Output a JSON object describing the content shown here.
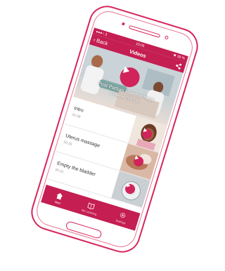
{
  "status": {
    "time": "15:05",
    "carrier": "3",
    "battery": "39 %"
  },
  "nav": {
    "back_label": "Back",
    "title": "Videos"
  },
  "hero": {
    "title": "Post Partum Haemorrhage",
    "subtitle": "9 videos (10:18)"
  },
  "videos": [
    {
      "title": "Intro",
      "duration": "01:08"
    },
    {
      "title": "Uterus massage",
      "duration": "00:25"
    },
    {
      "title": "Empty the bladder",
      "duration": "00:21"
    }
  ],
  "tabs": [
    {
      "label": "Main",
      "icon": "house-icon"
    },
    {
      "label": "My Learning",
      "icon": "book-icon"
    },
    {
      "label": "Settings",
      "icon": "gear-icon"
    }
  ],
  "colors": {
    "accent": "#c41e52",
    "play": "#d0245a",
    "outline": "#d6255a"
  }
}
